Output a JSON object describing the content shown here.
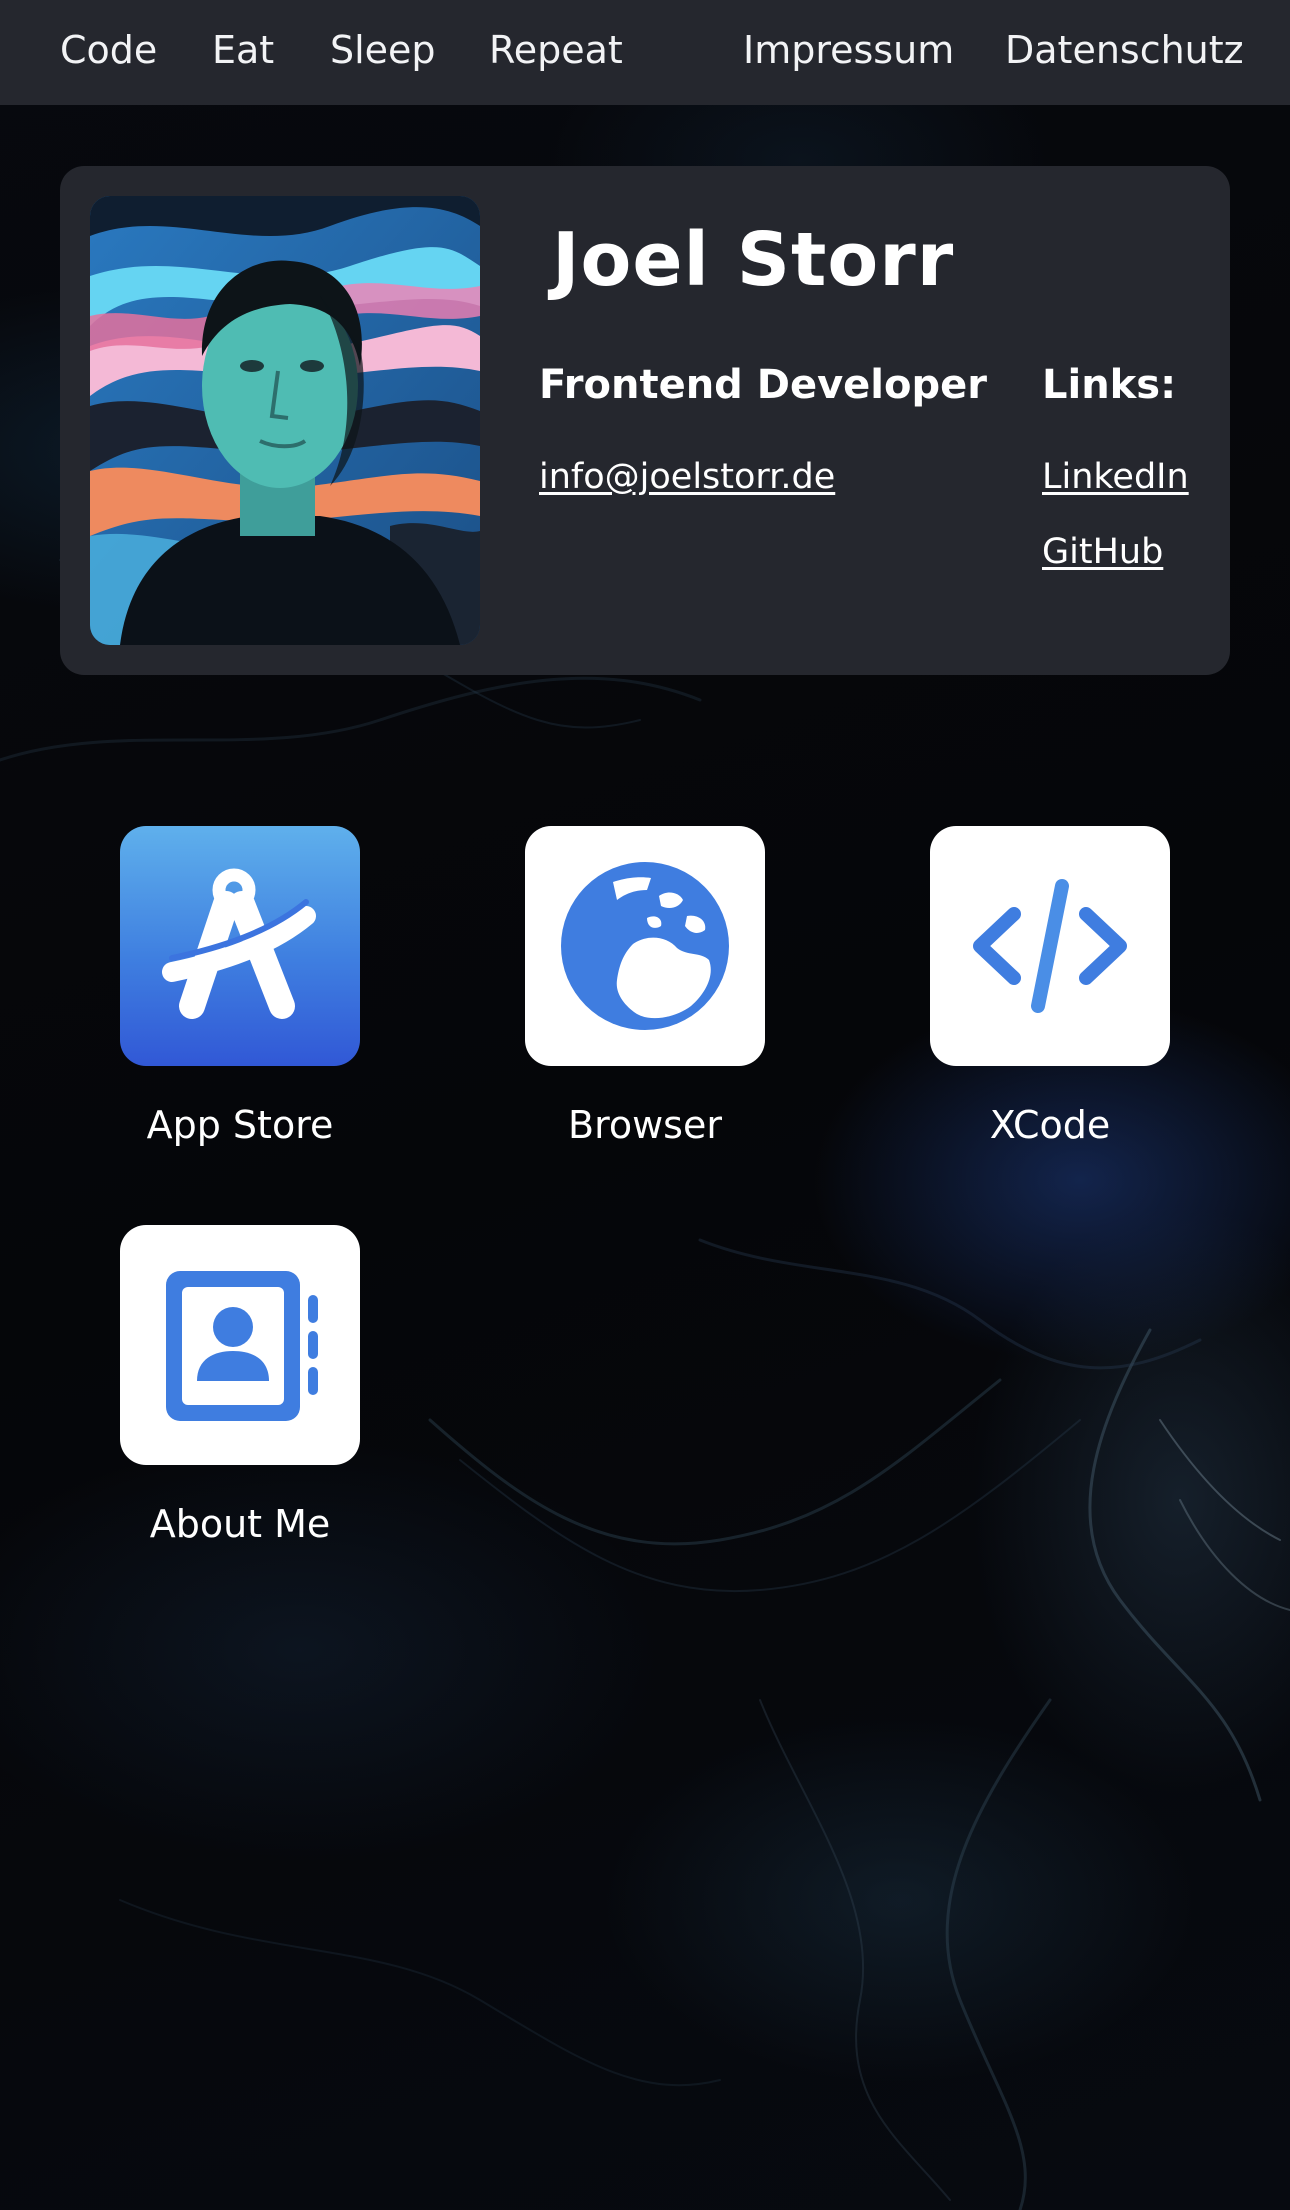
{
  "nav": {
    "left_items": [
      {
        "label": "Code"
      },
      {
        "label": "Eat"
      },
      {
        "label": "Sleep"
      },
      {
        "label": "Repeat"
      }
    ],
    "right_items": [
      {
        "label": "Impressum"
      },
      {
        "label": "Datenschutz"
      }
    ]
  },
  "profile": {
    "name": "Joel Storr",
    "role": "Frontend Developer",
    "email": "info@joelstorr.de",
    "links_heading": "Links:",
    "links": [
      {
        "label": "LinkedIn"
      },
      {
        "label": "GitHub"
      }
    ]
  },
  "apps": [
    {
      "label": "App Store",
      "icon": "app-store-icon"
    },
    {
      "label": "Browser",
      "icon": "globe-icon"
    },
    {
      "label": "XCode",
      "icon": "code-icon"
    },
    {
      "label": "About Me",
      "icon": "contact-book-icon"
    }
  ],
  "colors": {
    "nav_background": "#25272e",
    "card_background": "#25272e",
    "icon_blue": "#3f7de0",
    "text": "#ffffff"
  }
}
